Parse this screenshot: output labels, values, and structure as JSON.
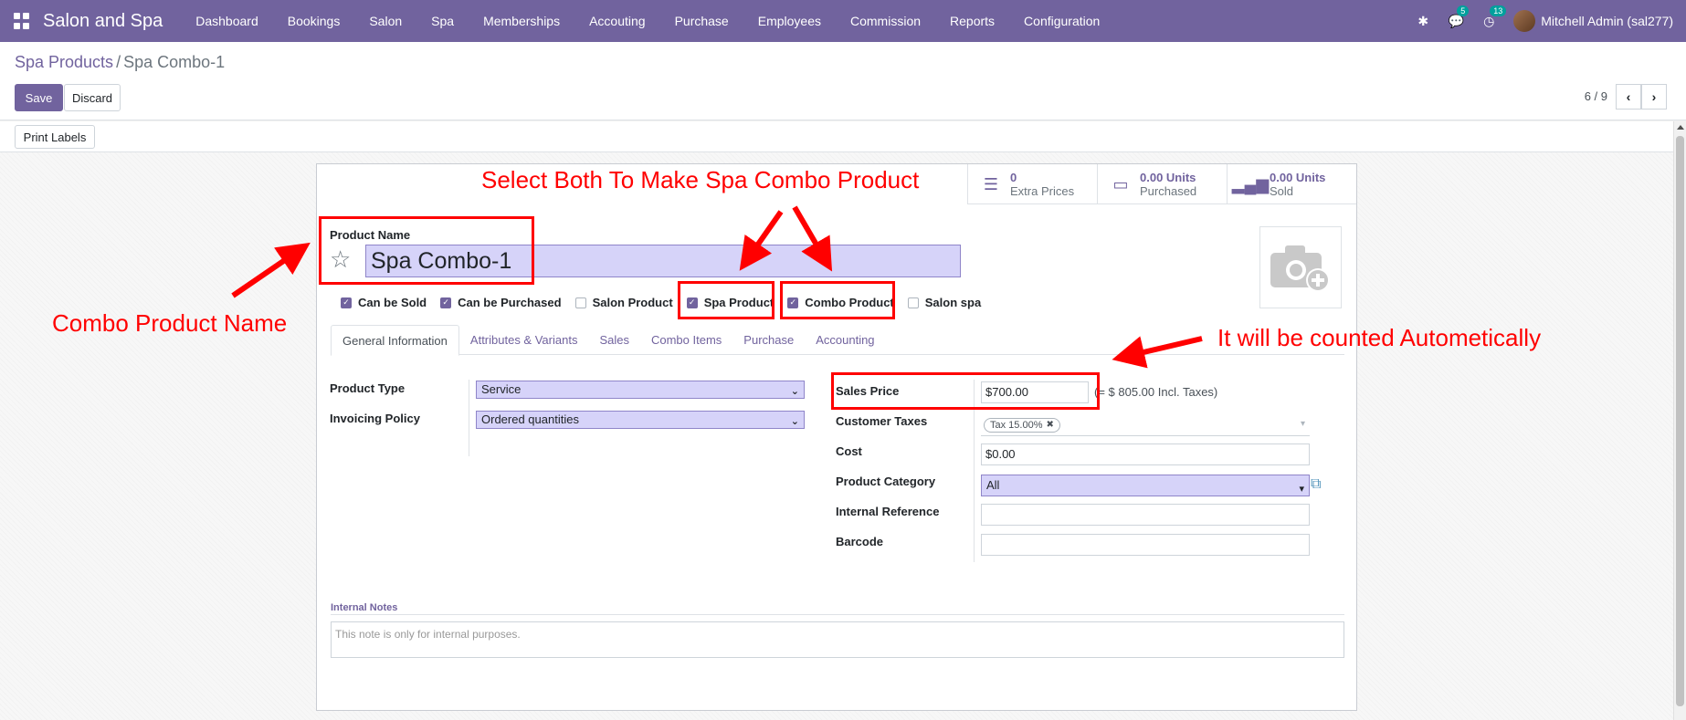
{
  "app": {
    "name": "Salon and Spa",
    "menu": [
      "Dashboard",
      "Bookings",
      "Salon",
      "Spa",
      "Memberships",
      "Accouting",
      "Purchase",
      "Employees",
      "Commission",
      "Reports",
      "Configuration"
    ],
    "messages_count": "5",
    "activities_count": "13",
    "user": "Mitchell Admin (sal277)"
  },
  "breadcrumb": {
    "parent": "Spa Products",
    "separator": "/",
    "current": "Spa Combo-1"
  },
  "toolbar": {
    "save_label": "Save",
    "discard_label": "Discard",
    "pager": "6 / 9",
    "print_labels": "Print Labels"
  },
  "smart_buttons": [
    {
      "value": "0",
      "label": "Extra Prices",
      "icon": "list-icon"
    },
    {
      "value": "0.00 Units",
      "label": "Purchased",
      "icon": "credit-card-icon"
    },
    {
      "value": "0.00 Units",
      "label": "Sold",
      "icon": "signal-icon"
    }
  ],
  "product": {
    "name_label": "Product Name",
    "name": "Spa Combo-1",
    "flags": [
      {
        "label": "Can be Sold",
        "checked": true
      },
      {
        "label": "Can be Purchased",
        "checked": true
      },
      {
        "label": "Salon Product",
        "checked": false
      },
      {
        "label": "Spa Product",
        "checked": true
      },
      {
        "label": "Combo Product",
        "checked": true
      },
      {
        "label": "Salon spa",
        "checked": false
      }
    ]
  },
  "tabs": [
    "General Information",
    "Attributes & Variants",
    "Sales",
    "Combo Items",
    "Purchase",
    "Accounting"
  ],
  "general": {
    "product_type_label": "Product Type",
    "product_type": "Service",
    "invoicing_policy_label": "Invoicing Policy",
    "invoicing_policy": "Ordered quantities",
    "sales_price_label": "Sales Price",
    "sales_price": "$700.00",
    "sales_price_incl": "(= $ 805.00 Incl. Taxes)",
    "customer_taxes_label": "Customer Taxes",
    "customer_tax_tag": "Tax 15.00%",
    "cost_label": "Cost",
    "cost": "$0.00",
    "product_category_label": "Product Category",
    "product_category": "All",
    "internal_reference_label": "Internal Reference",
    "internal_reference": "",
    "barcode_label": "Barcode",
    "barcode": ""
  },
  "notes": {
    "title": "Internal Notes",
    "placeholder": "This note is only for internal purposes."
  },
  "annotations": {
    "title_note": "Select Both To Make Spa Combo Product",
    "name_note": "Combo Product Name",
    "price_note": "It will be counted Autometically",
    "color": "#ff0000"
  },
  "colors": {
    "brand": "#71639e",
    "field_highlight": "#d6d3f9",
    "annotation": "#ff0000"
  }
}
